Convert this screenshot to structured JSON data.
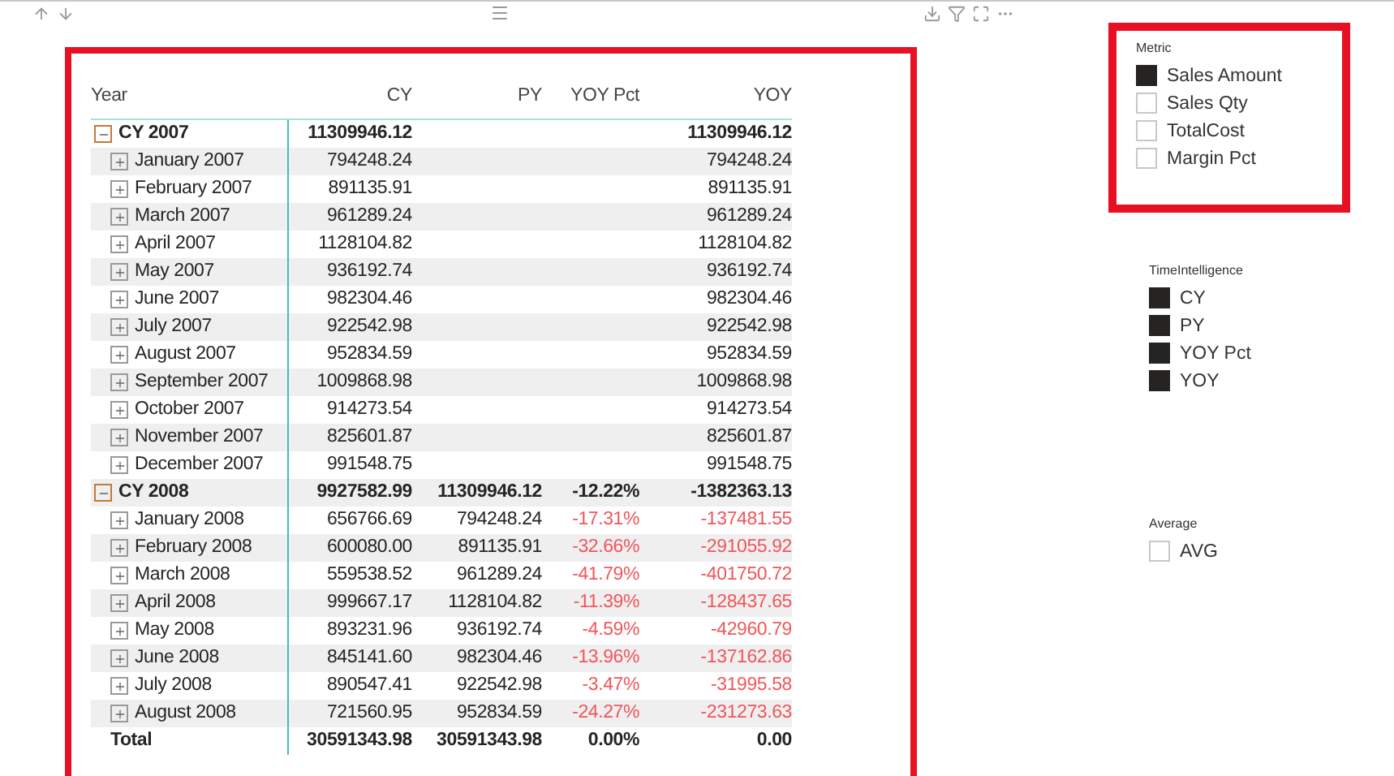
{
  "table": {
    "row_header": "Year",
    "columns": [
      "CY",
      "PY",
      "YOY Pct",
      "YOY"
    ],
    "rows": [
      {
        "kind": "year",
        "expanded": true,
        "label": "CY 2007",
        "cells": [
          "11309946.12",
          "",
          "",
          "11309946.12"
        ],
        "negative": false
      },
      {
        "kind": "month",
        "expanded": false,
        "label": "January 2007",
        "cells": [
          "794248.24",
          "",
          "",
          "794248.24"
        ],
        "negative": false
      },
      {
        "kind": "month",
        "expanded": false,
        "label": "February 2007",
        "cells": [
          "891135.91",
          "",
          "",
          "891135.91"
        ],
        "negative": false
      },
      {
        "kind": "month",
        "expanded": false,
        "label": "March 2007",
        "cells": [
          "961289.24",
          "",
          "",
          "961289.24"
        ],
        "negative": false
      },
      {
        "kind": "month",
        "expanded": false,
        "label": "April 2007",
        "cells": [
          "1128104.82",
          "",
          "",
          "1128104.82"
        ],
        "negative": false
      },
      {
        "kind": "month",
        "expanded": false,
        "label": "May 2007",
        "cells": [
          "936192.74",
          "",
          "",
          "936192.74"
        ],
        "negative": false
      },
      {
        "kind": "month",
        "expanded": false,
        "label": "June 2007",
        "cells": [
          "982304.46",
          "",
          "",
          "982304.46"
        ],
        "negative": false
      },
      {
        "kind": "month",
        "expanded": false,
        "label": "July 2007",
        "cells": [
          "922542.98",
          "",
          "",
          "922542.98"
        ],
        "negative": false
      },
      {
        "kind": "month",
        "expanded": false,
        "label": "August 2007",
        "cells": [
          "952834.59",
          "",
          "",
          "952834.59"
        ],
        "negative": false
      },
      {
        "kind": "month",
        "expanded": false,
        "label": "September 2007",
        "cells": [
          "1009868.98",
          "",
          "",
          "1009868.98"
        ],
        "negative": false
      },
      {
        "kind": "month",
        "expanded": false,
        "label": "October 2007",
        "cells": [
          "914273.54",
          "",
          "",
          "914273.54"
        ],
        "negative": false
      },
      {
        "kind": "month",
        "expanded": false,
        "label": "November 2007",
        "cells": [
          "825601.87",
          "",
          "",
          "825601.87"
        ],
        "negative": false
      },
      {
        "kind": "month",
        "expanded": false,
        "label": "December 2007",
        "cells": [
          "991548.75",
          "",
          "",
          "991548.75"
        ],
        "negative": false
      },
      {
        "kind": "year",
        "expanded": true,
        "label": "CY 2008",
        "cells": [
          "9927582.99",
          "11309946.12",
          "-12.22%",
          "-1382363.13"
        ],
        "negative": false
      },
      {
        "kind": "month",
        "expanded": false,
        "label": "January 2008",
        "cells": [
          "656766.69",
          "794248.24",
          "-17.31%",
          "-137481.55"
        ],
        "negative": true
      },
      {
        "kind": "month",
        "expanded": false,
        "label": "February 2008",
        "cells": [
          "600080.00",
          "891135.91",
          "-32.66%",
          "-291055.92"
        ],
        "negative": true
      },
      {
        "kind": "month",
        "expanded": false,
        "label": "March 2008",
        "cells": [
          "559538.52",
          "961289.24",
          "-41.79%",
          "-401750.72"
        ],
        "negative": true
      },
      {
        "kind": "month",
        "expanded": false,
        "label": "April 2008",
        "cells": [
          "999667.17",
          "1128104.82",
          "-11.39%",
          "-128437.65"
        ],
        "negative": true
      },
      {
        "kind": "month",
        "expanded": false,
        "label": "May 2008",
        "cells": [
          "893231.96",
          "936192.74",
          "-4.59%",
          "-42960.79"
        ],
        "negative": true
      },
      {
        "kind": "month",
        "expanded": false,
        "label": "June 2008",
        "cells": [
          "845141.60",
          "982304.46",
          "-13.96%",
          "-137162.86"
        ],
        "negative": true
      },
      {
        "kind": "month",
        "expanded": false,
        "label": "July 2008",
        "cells": [
          "890547.41",
          "922542.98",
          "-3.47%",
          "-31995.58"
        ],
        "negative": true
      },
      {
        "kind": "month",
        "expanded": false,
        "label": "August 2008",
        "cells": [
          "721560.95",
          "952834.59",
          "-24.27%",
          "-231273.63"
        ],
        "negative": true
      }
    ],
    "total": {
      "label": "Total",
      "cells": [
        "30591343.98",
        "30591343.98",
        "0.00%",
        "0.00"
      ]
    }
  },
  "slicers": [
    {
      "title": "Metric",
      "highlighted": true,
      "items": [
        {
          "label": "Sales Amount",
          "checked": true
        },
        {
          "label": "Sales Qty",
          "checked": false
        },
        {
          "label": "TotalCost",
          "checked": false
        },
        {
          "label": "Margin Pct",
          "checked": false
        }
      ]
    },
    {
      "title": "TimeIntelligence",
      "highlighted": false,
      "items": [
        {
          "label": "CY",
          "checked": true
        },
        {
          "label": "PY",
          "checked": true
        },
        {
          "label": "YOY Pct",
          "checked": true
        },
        {
          "label": "YOY",
          "checked": true
        }
      ]
    },
    {
      "title": "Average",
      "highlighted": false,
      "items": [
        {
          "label": "AVG",
          "checked": false
        }
      ]
    }
  ]
}
